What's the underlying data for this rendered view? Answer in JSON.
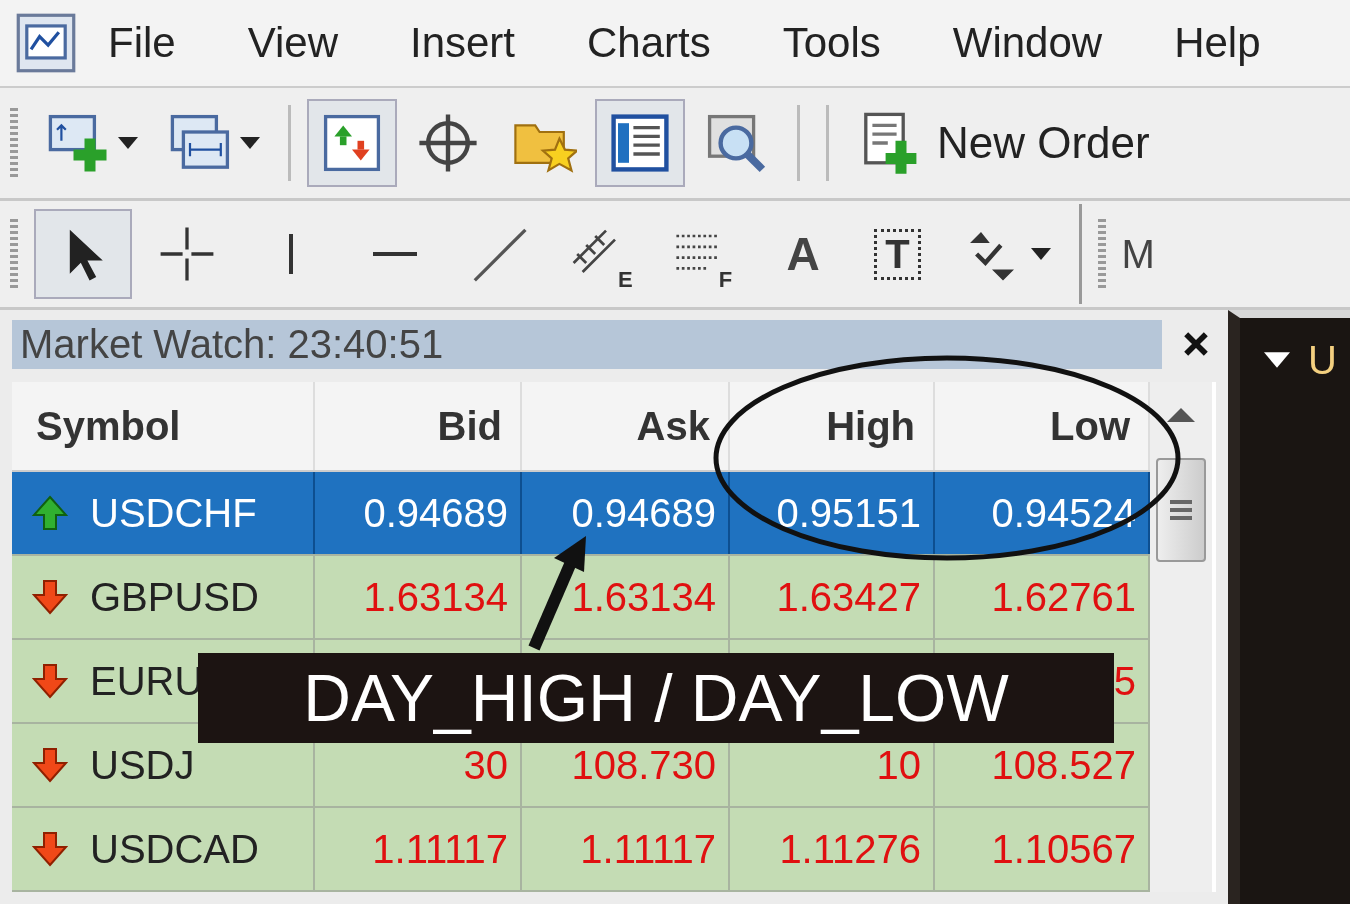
{
  "menu": [
    "File",
    "View",
    "Insert",
    "Charts",
    "Tools",
    "Window",
    "Help"
  ],
  "toolbar": [
    {
      "kind": "new-chart",
      "selected": false
    },
    {
      "kind": "profiles",
      "selected": false
    },
    {
      "kind": "market-watch",
      "selected": true
    },
    {
      "kind": "crosshair",
      "selected": false
    },
    {
      "kind": "favorites",
      "selected": false
    },
    {
      "kind": "terminal",
      "selected": true
    },
    {
      "kind": "tester",
      "selected": false
    },
    {
      "kind": "new-order",
      "selected": false,
      "label": "New Order"
    }
  ],
  "drawing_tools": [
    {
      "kind": "cursor",
      "selected": true
    },
    {
      "kind": "crosshair",
      "selected": false
    },
    {
      "kind": "vline",
      "selected": false
    },
    {
      "kind": "hline",
      "selected": false
    },
    {
      "kind": "trend",
      "selected": false
    },
    {
      "kind": "channel",
      "selected": false,
      "label": "E"
    },
    {
      "kind": "fibo",
      "selected": false,
      "label": "F"
    },
    {
      "kind": "text",
      "selected": false,
      "label": "A"
    },
    {
      "kind": "label",
      "selected": false,
      "label": "T"
    },
    {
      "kind": "arrows",
      "selected": false
    }
  ],
  "next_toolbar": {
    "label": "M"
  },
  "market_watch": {
    "title": "Market Watch: 23:40:51",
    "columns": [
      "Symbol",
      "Bid",
      "Ask",
      "High",
      "Low"
    ],
    "rows": [
      {
        "kind": "up",
        "selected": true,
        "symbol": "USDCHF",
        "bid": "0.94689",
        "ask": "0.94689",
        "high": "0.95151",
        "low": "0.94524"
      },
      {
        "kind": "down",
        "selected": false,
        "symbol": "GBPUSD",
        "bid": "1.63134",
        "ask": "1.63134",
        "high": "1.63427",
        "low": "1.62761"
      },
      {
        "kind": "down",
        "selected": false,
        "symbol": "EURU",
        "low": "5"
      },
      {
        "kind": "down",
        "selected": false,
        "symbol": "USDJ",
        "bid": "30",
        "ask": "108.730",
        "high": "10",
        "low": "108.527"
      },
      {
        "kind": "down",
        "selected": false,
        "symbol": "USDCAD",
        "bid": "1.11117",
        "ask": "1.11117",
        "high": "1.11276",
        "low": "1.10567"
      }
    ]
  },
  "chart_window": {
    "title": "U"
  },
  "annotation": {
    "label": "DAY_HIGH / DAY_LOW"
  }
}
